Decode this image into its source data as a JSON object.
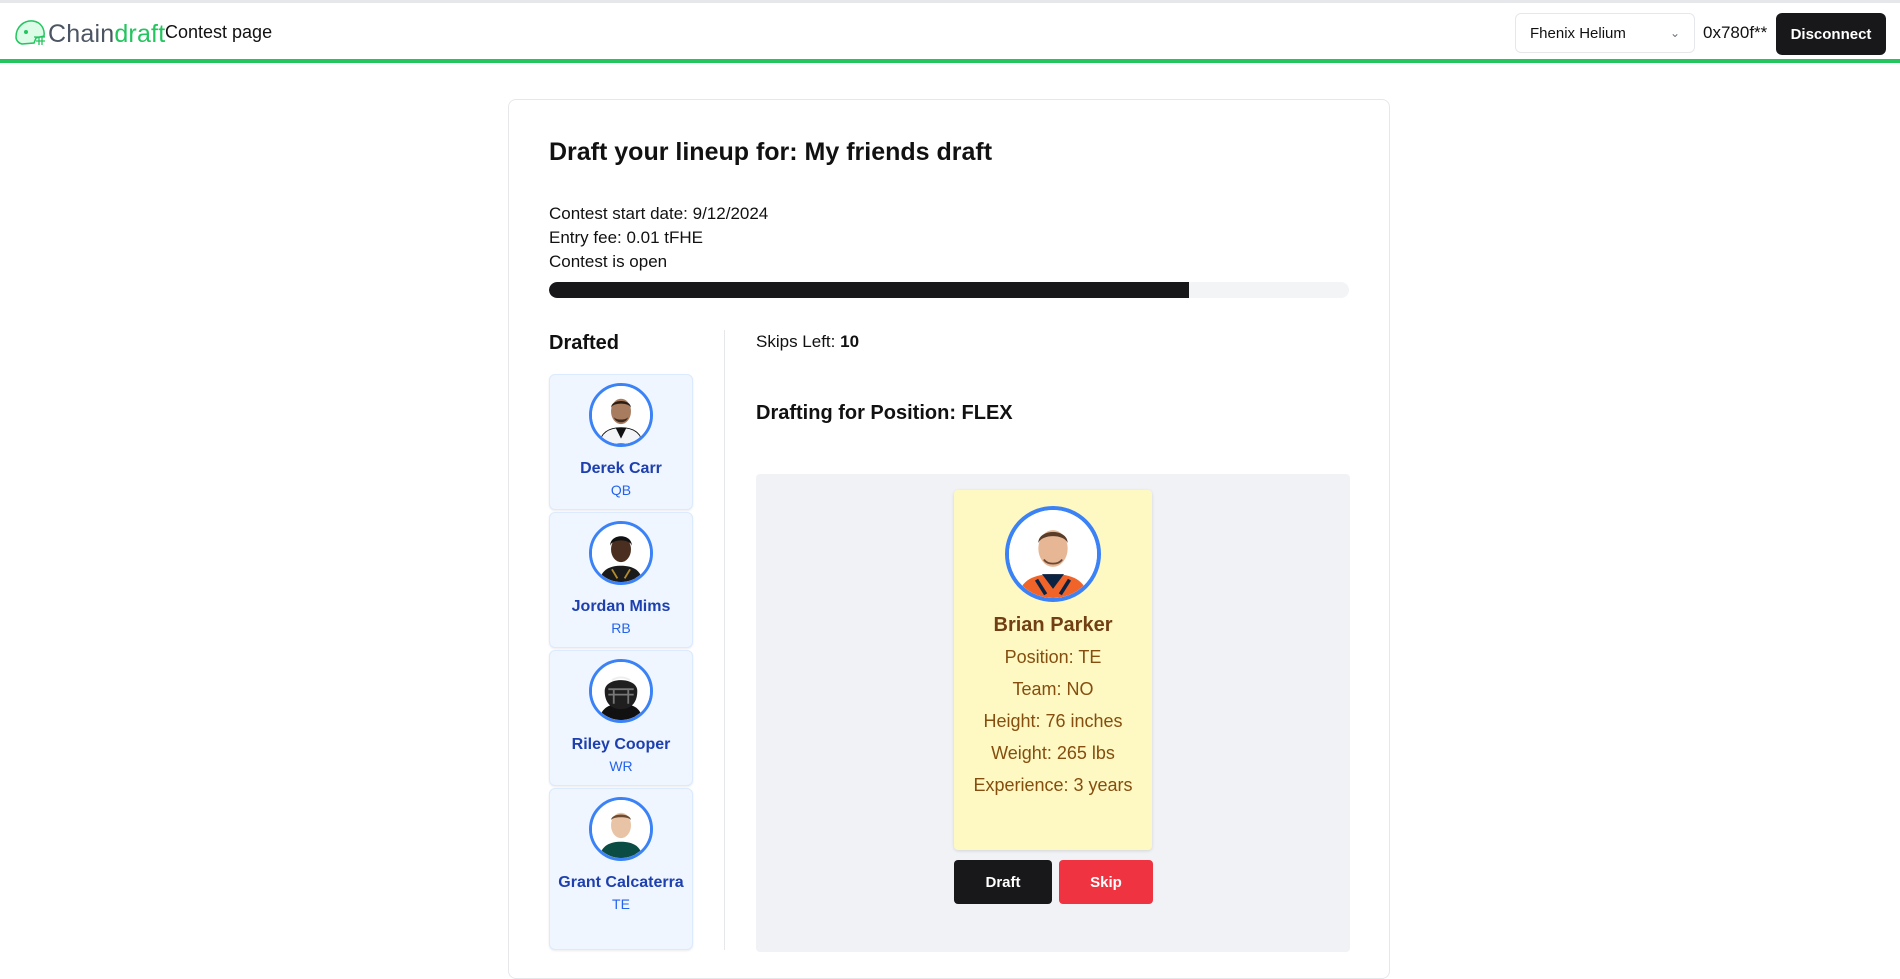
{
  "header": {
    "logo_part1": "Chain",
    "logo_part2": "draft",
    "page_title": "Contest page",
    "network": "Fhenix Helium",
    "wallet_address": "0x780f**",
    "disconnect_label": "Disconnect",
    "accent_color": "#22c55e"
  },
  "contest": {
    "title": "Draft your lineup for: My friends draft",
    "start_date": "Contest start date: 9/12/2024",
    "entry_fee": "Entry fee: 0.01 tFHE",
    "status": "Contest is open",
    "progress_percent": 80
  },
  "drafted": {
    "title": "Drafted",
    "players": [
      {
        "name": "Derek Carr",
        "position": "QB"
      },
      {
        "name": "Jordan Mims",
        "position": "RB"
      },
      {
        "name": "Riley Cooper",
        "position": "WR"
      },
      {
        "name": "Grant Calcaterra",
        "position": "TE"
      }
    ]
  },
  "draft_panel": {
    "skips_label": "Skips Left:",
    "skips_value": "10",
    "drafting_for": "Drafting for Position: FLEX",
    "candidate": {
      "name": "Brian Parker",
      "position": "Position: TE",
      "team": "Team: NO",
      "height": "Height: 76 inches",
      "weight": "Weight: 265 lbs",
      "experience": "Experience: 3 years"
    },
    "draft_label": "Draft",
    "skip_label": "Skip"
  }
}
